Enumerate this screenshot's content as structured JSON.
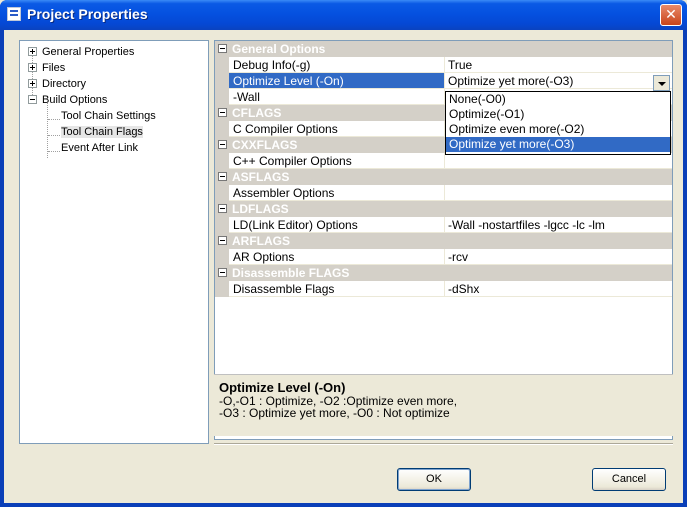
{
  "window": {
    "title": "Project Properties",
    "close_glyph": "✕"
  },
  "tree": {
    "items": [
      {
        "label": "General Properties",
        "expander": "plus"
      },
      {
        "label": "Files",
        "expander": "plus"
      },
      {
        "label": "Directory",
        "expander": "plus"
      },
      {
        "label": "Build Options",
        "expander": "minus"
      },
      {
        "label": "Tool Chain Settings"
      },
      {
        "label": "Tool Chain Flags",
        "selected": true
      },
      {
        "label": "Event After Link"
      }
    ]
  },
  "grid": {
    "categories": {
      "general": "General Options",
      "cflags": "CFLAGS",
      "cxxflags": "CXXFLAGS",
      "asflags": "ASFLAGS",
      "ldflags": "LDFLAGS",
      "arflags": "ARFLAGS",
      "disasm": "Disassemble FLAGS"
    },
    "props": {
      "debug_info": {
        "name": "Debug Info(-g)",
        "value": "True"
      },
      "optimize": {
        "name": "Optimize Level (-On)",
        "value": "Optimize yet more(-O3)"
      },
      "wall": {
        "name": "-Wall",
        "value": ""
      },
      "c_opts": {
        "name": "C Compiler Options",
        "value": ""
      },
      "cpp_opts": {
        "name": "C++ Compiler Options",
        "value": ""
      },
      "asm_opts": {
        "name": "Assembler Options",
        "value": ""
      },
      "ld_opts": {
        "name": "LD(Link Editor) Options",
        "value": "-Wall -nostartfiles -lgcc -lc -lm"
      },
      "ar_opts": {
        "name": "AR Options",
        "value": "-rcv"
      },
      "disasm_flags": {
        "name": "Disassemble Flags",
        "value": "-dShx"
      }
    },
    "dropdown_options": [
      "None(-O0)",
      "Optimize(-O1)",
      "Optimize even more(-O2)",
      "Optimize yet more(-O3)"
    ]
  },
  "description": {
    "title": "Optimize Level (-On)",
    "line1": "-O,-O1 : Optimize,  -O2 :Optimize  even more,",
    "line2": "-O3 : Optimize yet more,  -O0 : Not optimize"
  },
  "buttons": {
    "ok": "OK",
    "cancel": "Cancel"
  }
}
